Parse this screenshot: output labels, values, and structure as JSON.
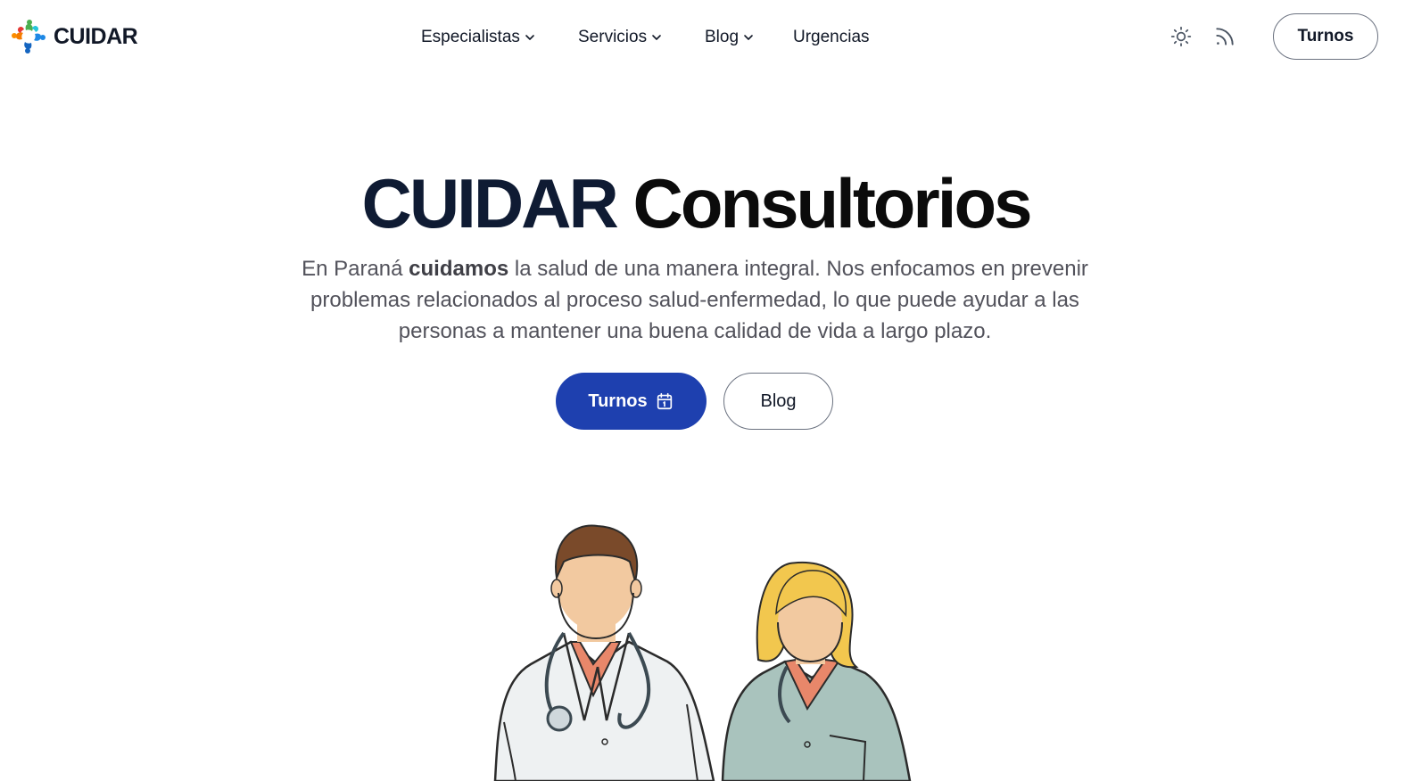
{
  "brand": {
    "name": "CUIDAR",
    "logo_icon": "cuidar-logo-icon"
  },
  "nav": {
    "items": [
      {
        "label": "Especialistas",
        "has_dropdown": true
      },
      {
        "label": "Servicios",
        "has_dropdown": true
      },
      {
        "label": "Blog",
        "has_dropdown": true
      },
      {
        "label": "Urgencias",
        "has_dropdown": false
      }
    ]
  },
  "header": {
    "theme_icon": "sun-icon",
    "rss_icon": "rss-icon",
    "cta_label": "Turnos"
  },
  "hero": {
    "title_part1": "CUIDAR",
    "title_part2": "Consultorios",
    "desc_prefix": "En Paraná ",
    "desc_bold": "cuidamos",
    "desc_suffix": " la salud de una manera integral. Nos enfocamos en prevenir problemas relacionados al proceso salud-enfermedad, lo que puede ayudar a las personas a mantener una buena calidad de vida a largo plazo.",
    "primary_label": "Turnos",
    "primary_icon": "calendar-icon",
    "secondary_label": "Blog",
    "illustration": "doctors-illustration"
  },
  "colors": {
    "primary": "#1e40af",
    "title_dark": "#0f1b33",
    "text_muted": "#52525b",
    "coat_green": "#a9c3bd",
    "hair_brown": "#7a4a2a",
    "hair_blonde": "#f2c74e",
    "skin": "#f2c9a0",
    "shirt": "#e8876a"
  }
}
